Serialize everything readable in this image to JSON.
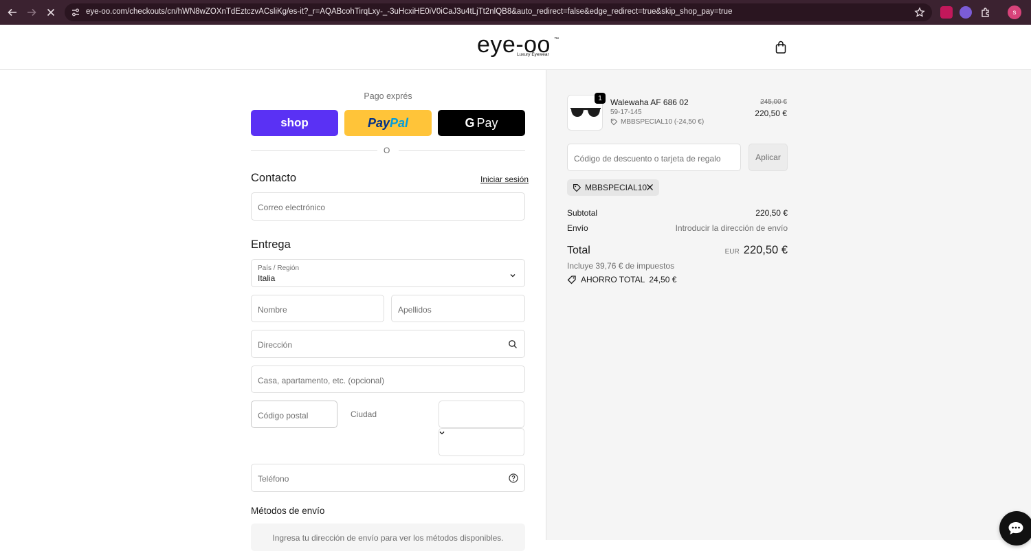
{
  "browser": {
    "url": "eye-oo.com/checkouts/cn/hWN8wZOXnTdEztczvACsliKg/es-it?_r=AQABcohTirqLxy-_-3uHcxiHE0iV0iCaJ3u4tLjTt2nlQB8&auto_redirect=false&edge_redirect=true&skip_shop_pay=true",
    "profile_initial": "s"
  },
  "header": {
    "logo_main": "eye-oo",
    "logo_tm": "™",
    "logo_sub": "Luxury Eyewear"
  },
  "express": {
    "title": "Pago exprés",
    "shop_label": "shop",
    "paypal_dark": "Pay",
    "paypal_light": "Pal",
    "gpay_g": "G",
    "gpay_label": "Pay",
    "or_text": "O"
  },
  "contact": {
    "title": "Contacto",
    "login_link": "Iniciar sesión",
    "email_placeholder": "Correo electrónico"
  },
  "delivery": {
    "title": "Entrega",
    "country_label": "País / Región",
    "country_value": "Italia",
    "name_placeholder": "Nombre",
    "lastname_placeholder": "Apellidos",
    "address_placeholder": "Dirección",
    "apartment_placeholder": "Casa, apartamento, etc. (opcional)",
    "zip_placeholder": "Código postal",
    "city_label": "Ciudad",
    "phone_placeholder": "Teléfono"
  },
  "shipping": {
    "title": "Métodos de envío",
    "message": "Ingresa tu dirección de envío para ver los métodos disponibles."
  },
  "summary": {
    "product": {
      "quantity": "1",
      "name": "Walewaha AF 686 02",
      "variant": "59-17-145",
      "discount": "MBBSPECIAL10 (-24,50 €)",
      "old_price": "245,00 €",
      "new_price": "220,50 €"
    },
    "discount_placeholder": "Código de descuento o tarjeta de regalo",
    "apply_label": "Aplicar",
    "applied_code": "MBBSPECIAL10",
    "subtotal_label": "Subtotal",
    "subtotal_value": "220,50 €",
    "shipping_label": "Envío",
    "shipping_value": "Introducir la dirección de envío",
    "total_label": "Total",
    "total_currency": "EUR",
    "total_value": "220,50 €",
    "tax_note": "Incluye 39,76 € de impuestos",
    "savings_label": "AHORRO TOTAL",
    "savings_value": "24,50 €"
  },
  "colors": {
    "shop": "#5a31f4",
    "paypal": "#ffc439",
    "gpay": "#000000",
    "browser_bar": "#3b2230"
  }
}
